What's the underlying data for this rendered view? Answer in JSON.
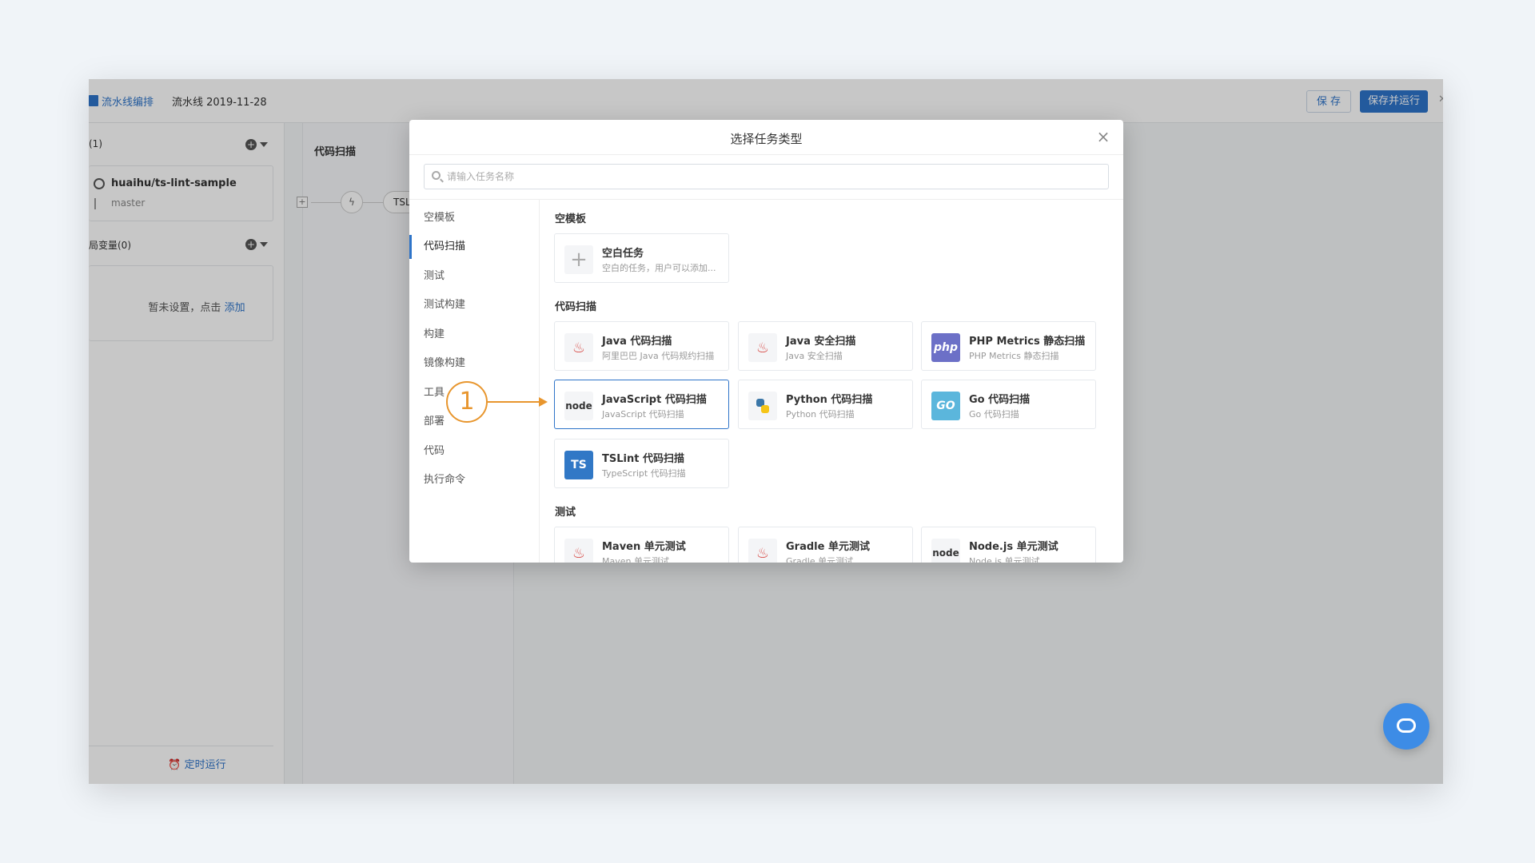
{
  "topbar": {
    "nav_label": "流水线编排",
    "pipeline_name": "流水线 2019-11-28",
    "save_label": "保 存",
    "save_run_label": "保存并运行"
  },
  "left_panel": {
    "sources_title": "(1)",
    "repo_name": "huaihu/ts-lint-sample",
    "repo_branch": "master",
    "vars_title": "局变量(0)",
    "vars_empty": "暂未设置，点击",
    "vars_add_link": "添加",
    "schedule_label": "定时运行"
  },
  "stage": {
    "title": "代码扫描",
    "node_label": "TSL"
  },
  "modal": {
    "title": "选择任务类型",
    "search_placeholder": "请输入任务名称",
    "sidebar": [
      {
        "label": "空模板"
      },
      {
        "label": "代码扫描"
      },
      {
        "label": "测试"
      },
      {
        "label": "测试构建"
      },
      {
        "label": "构建"
      },
      {
        "label": "镜像构建"
      },
      {
        "label": "工具"
      },
      {
        "label": "部署"
      },
      {
        "label": "代码"
      },
      {
        "label": "执行命令"
      }
    ],
    "groups": {
      "empty": {
        "title": "空模板",
        "cards": [
          {
            "title": "空白任务",
            "sub": "空白的任务，用户可以添加...",
            "icon": "plus-icon"
          }
        ]
      },
      "scan": {
        "title": "代码扫描",
        "cards": [
          {
            "title": "Java 代码扫描",
            "sub": "阿里巴巴 Java 代码规约扫描",
            "icon": "java-icon"
          },
          {
            "title": "Java 安全扫描",
            "sub": "Java 安全扫描",
            "icon": "java-icon"
          },
          {
            "title": "PHP Metrics 静态扫描",
            "sub": "PHP Metrics 静态扫描",
            "icon": "php-icon"
          },
          {
            "title": "JavaScript 代码扫描",
            "sub": "JavaScript 代码扫描",
            "icon": "node-icon"
          },
          {
            "title": "Python 代码扫描",
            "sub": "Python 代码扫描",
            "icon": "python-icon"
          },
          {
            "title": "Go 代码扫描",
            "sub": "Go 代码扫描",
            "icon": "go-icon"
          },
          {
            "title": "TSLint 代码扫描",
            "sub": "TypeScript 代码扫描",
            "icon": "ts-icon"
          }
        ]
      },
      "test": {
        "title": "测试",
        "cards": [
          {
            "title": "Maven 单元测试",
            "sub": "Maven 单元测试",
            "icon": "java-icon"
          },
          {
            "title": "Gradle 单元测试",
            "sub": "Gradle 单元测试",
            "icon": "java-icon"
          },
          {
            "title": "Node.js 单元测试",
            "sub": "Node.js 单元测试",
            "icon": "node-icon"
          }
        ]
      }
    },
    "icon_text": {
      "php": "php",
      "node": "node",
      "go": "GO",
      "ts": "TS",
      "plus": "+",
      "java": "♨"
    }
  },
  "callout": {
    "number": "1"
  },
  "colors": {
    "accent": "#2e74c9",
    "callout": "#e8962e"
  }
}
